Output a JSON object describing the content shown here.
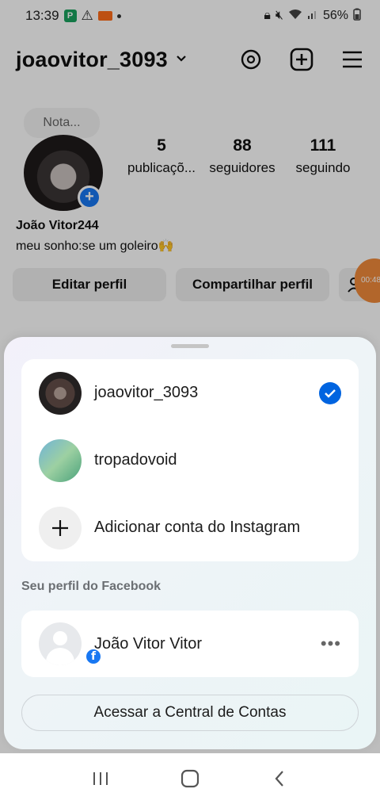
{
  "status_bar": {
    "time": "13:39",
    "battery": "56%"
  },
  "profile": {
    "username": "joaovitor_3093",
    "note_placeholder": "Nota...",
    "stats": [
      {
        "value": "5",
        "label": "publicaçõ..."
      },
      {
        "value": "88",
        "label": "seguidores"
      },
      {
        "value": "111",
        "label": "seguindo"
      }
    ],
    "display_name": "João Vitor244",
    "bio": "meu sonho:se um goleiro🙌",
    "edit_button": "Editar perfil",
    "share_button": "Compartilhar perfil",
    "floating_timer": "00:48"
  },
  "sheet": {
    "accounts": [
      {
        "name": "joaovitor_3093",
        "selected": true
      },
      {
        "name": "tropadovoid",
        "selected": false
      }
    ],
    "add_account_label": "Adicionar conta do Instagram",
    "facebook_section_label": "Seu perfil do Facebook",
    "facebook_profile_name": "João Vitor Vitor",
    "facebook_more": "•••",
    "accounts_center_button": "Acessar a Central de Contas"
  },
  "colors": {
    "accent_blue": "#0064e0",
    "facebook_blue": "#1877f2"
  }
}
